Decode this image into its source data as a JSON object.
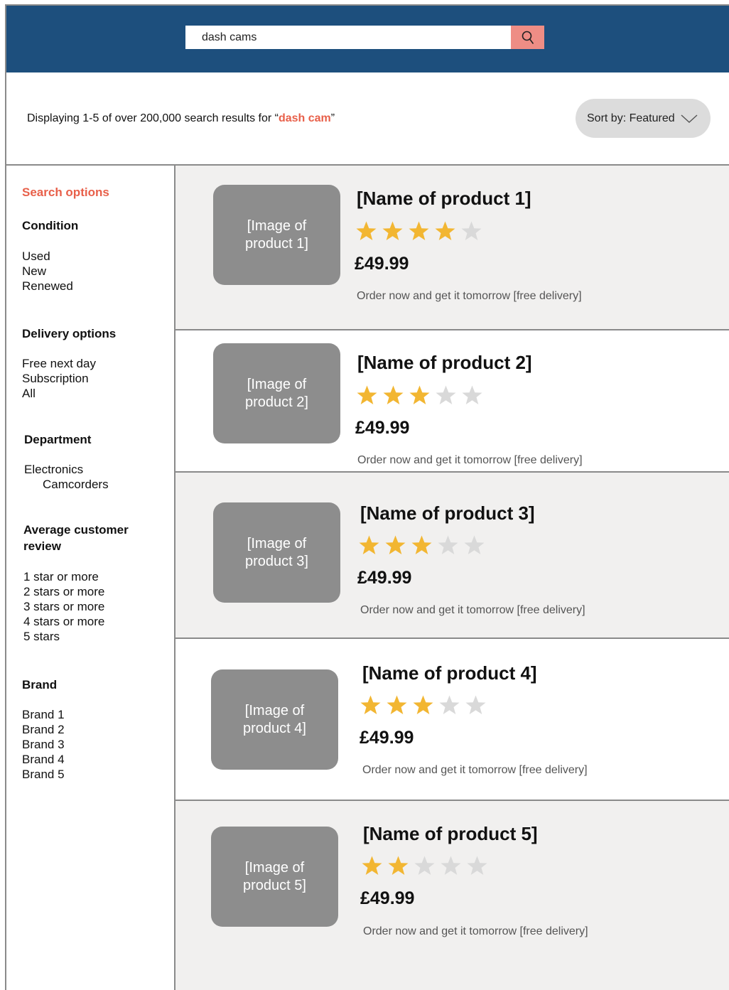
{
  "search": {
    "value": "dash cams",
    "button_icon": "search-icon"
  },
  "results": {
    "prefix": "Displaying 1-5 of over 200,000 search results for “",
    "query": "dash cam",
    "suffix": "”"
  },
  "sort": {
    "label": "Sort by: Featured",
    "icon": "chevron-down-icon"
  },
  "sidebar": {
    "title": "Search options",
    "condition": {
      "heading": "Condition",
      "items": [
        "Used",
        "New",
        "Renewed"
      ]
    },
    "delivery": {
      "heading": "Delivery options",
      "items": [
        "Free next day",
        "Subscription",
        "All"
      ]
    },
    "department": {
      "heading": "Department",
      "items": [
        "Electronics",
        "Camcorders"
      ]
    },
    "review": {
      "heading_line1": "Average customer",
      "heading_line2": "review",
      "items": [
        "1 star or more",
        "2 stars or more",
        "3 stars or more",
        "4 stars or more",
        "5 stars"
      ]
    },
    "brand": {
      "heading": "Brand",
      "items": [
        "Brand 1",
        "Brand 2",
        "Brand 3",
        "Brand 4",
        "Brand 5"
      ]
    }
  },
  "products": [
    {
      "name": "[Name of product 1]",
      "image_line1": "[Image of",
      "image_line2": "product 1]",
      "rating": 4,
      "price": "£49.99",
      "delivery": "Order now and get it tomorrow [free delivery]"
    },
    {
      "name": "[Name of product 2]",
      "image_line1": "[Image of",
      "image_line2": "product 2]",
      "rating": 3,
      "price": "£49.99",
      "delivery": "Order now and get it tomorrow [free delivery]"
    },
    {
      "name": "[Name of product 3]",
      "image_line1": "[Image of",
      "image_line2": "product 3]",
      "rating": 3,
      "price": "£49.99",
      "delivery": "Order now and get it tomorrow [free delivery]"
    },
    {
      "name": "[Name of product 4]",
      "image_line1": "[Image of",
      "image_line2": "product 4]",
      "rating": 3,
      "price": "£49.99",
      "delivery": "Order now and get it tomorrow [free delivery]"
    },
    {
      "name": "[Name of product 5]",
      "image_line1": "[Image of",
      "image_line2": "product 5]",
      "rating": 2,
      "price": "£49.99",
      "delivery": "Order now and get it tomorrow [free delivery]"
    }
  ],
  "colors": {
    "header": "#1d4f7d",
    "accent": "#e8604a",
    "search_button": "#ee8d85",
    "star_filled": "#f2b632",
    "star_empty": "#d9d9d9"
  }
}
